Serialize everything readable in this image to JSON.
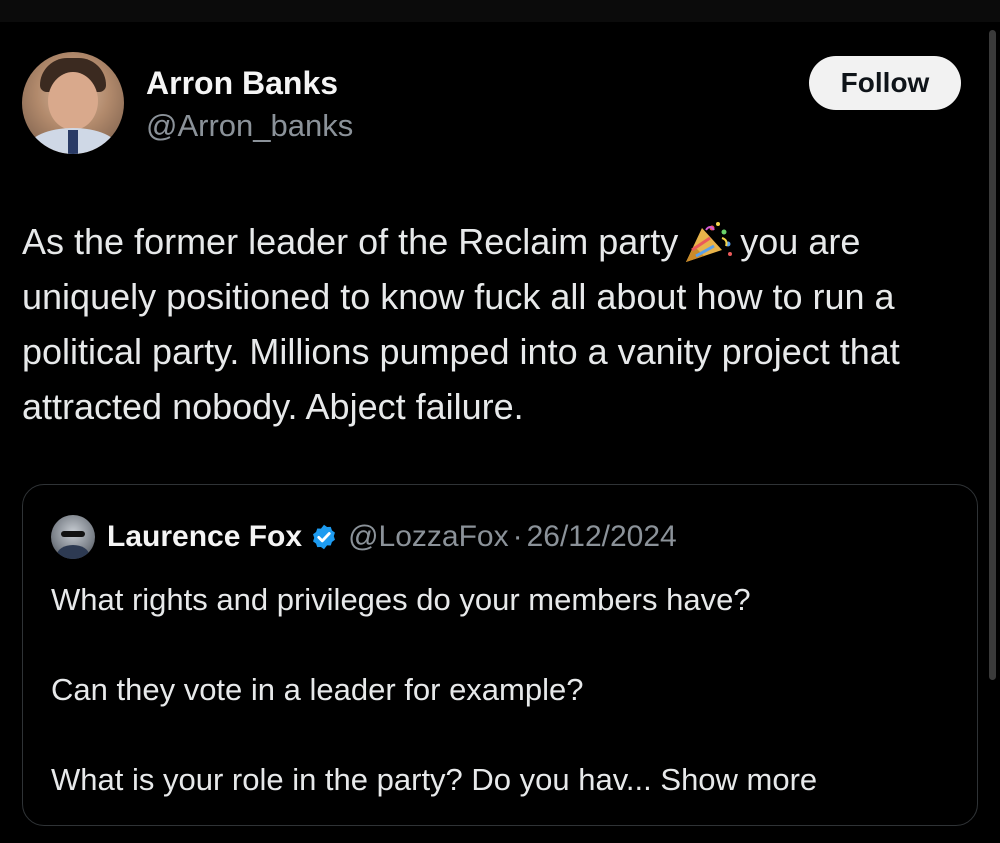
{
  "tweet": {
    "author": {
      "name": "Arron Banks",
      "handle": "@Arron_banks",
      "avatar_icon": "avatar-photo"
    },
    "follow_label": "Follow",
    "text": {
      "part1": "As the former leader of the Reclaim party",
      "emoji": "party-popper-icon",
      "part2": "you are uniquely positioned to know fuck all about how to run a political party. Millions pumped into a vanity project that attracted nobody. Abject failure."
    }
  },
  "quote": {
    "author": {
      "name": "Laurence Fox",
      "verified_icon": "verified-badge-icon",
      "handle": "@LozzaFox",
      "date": "26/12/2024"
    },
    "separator": "·",
    "paragraphs": [
      "What rights and privileges do your members have?",
      "Can they vote in a leader for example?",
      "What is your role in the party? Do you hav..."
    ],
    "show_more_label": "Show more"
  },
  "colors": {
    "background": "#000000",
    "text": "#e7e9ea",
    "secondary_text": "#8b9299",
    "follow_bg": "#f2f2f2",
    "verified": "#1d9bf0",
    "border": "#2f3336"
  }
}
